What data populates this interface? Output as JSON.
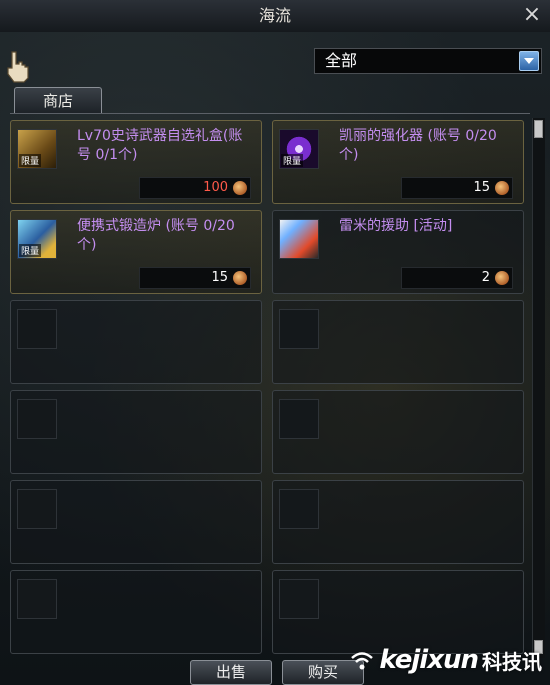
{
  "window": {
    "title": "海流"
  },
  "filter": {
    "selected": "全部"
  },
  "tabs": [
    {
      "label": "商店"
    }
  ],
  "shop_items": [
    {
      "name": "Lv70史诗武器自选礼盒(账号 0/1个)",
      "icon": "chest-icon",
      "badge": "限量",
      "price": "100"
    },
    {
      "name": "凯丽的强化器 (账号 0/20个)",
      "icon": "orb-icon",
      "badge": "限量",
      "price": "15"
    },
    {
      "name": "便携式锻造炉 (账号 0/20个)",
      "icon": "forge-icon",
      "badge": "限量",
      "price": "15"
    },
    {
      "name": "雷米的援助 [活动]",
      "icon": "help-icon",
      "badge": "",
      "price": "2"
    }
  ],
  "buttons": {
    "sell": "出售",
    "buy": "购买"
  },
  "watermark": {
    "brand": "kejixun",
    "cn": "科技讯"
  },
  "colors": {
    "item_name": "#c48ef0",
    "price_red": "#ff5a4a",
    "accent_blue": "#2d63a5"
  }
}
